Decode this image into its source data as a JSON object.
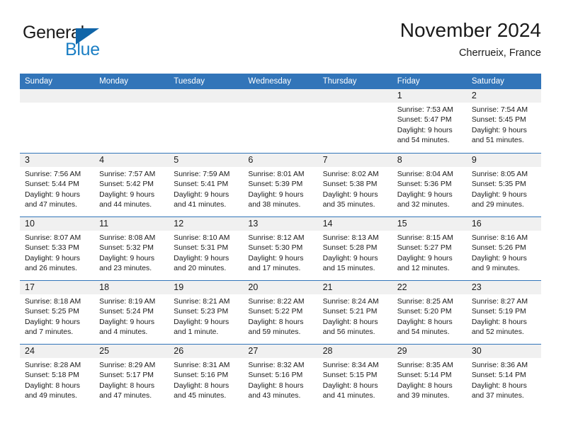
{
  "brand": {
    "name_part1": "General",
    "name_part2": "Blue",
    "accent_color": "#1c7fc4",
    "triangle_color": "#1065a8",
    "triangle_icon": "triangle-right-icon"
  },
  "header": {
    "title": "November 2024",
    "subtitle": "Cherrueix, France"
  },
  "theme": {
    "header_blue": "#3275b9",
    "day_band_gray": "#f0f0f0",
    "text_color": "#1a1a1a"
  },
  "weekdays": [
    "Sunday",
    "Monday",
    "Tuesday",
    "Wednesday",
    "Thursday",
    "Friday",
    "Saturday"
  ],
  "weeks": [
    [
      {
        "day": "",
        "info": ""
      },
      {
        "day": "",
        "info": ""
      },
      {
        "day": "",
        "info": ""
      },
      {
        "day": "",
        "info": ""
      },
      {
        "day": "",
        "info": ""
      },
      {
        "day": "1",
        "info": "Sunrise: 7:53 AM\nSunset: 5:47 PM\nDaylight: 9 hours\nand 54 minutes."
      },
      {
        "day": "2",
        "info": "Sunrise: 7:54 AM\nSunset: 5:45 PM\nDaylight: 9 hours\nand 51 minutes."
      }
    ],
    [
      {
        "day": "3",
        "info": "Sunrise: 7:56 AM\nSunset: 5:44 PM\nDaylight: 9 hours\nand 47 minutes."
      },
      {
        "day": "4",
        "info": "Sunrise: 7:57 AM\nSunset: 5:42 PM\nDaylight: 9 hours\nand 44 minutes."
      },
      {
        "day": "5",
        "info": "Sunrise: 7:59 AM\nSunset: 5:41 PM\nDaylight: 9 hours\nand 41 minutes."
      },
      {
        "day": "6",
        "info": "Sunrise: 8:01 AM\nSunset: 5:39 PM\nDaylight: 9 hours\nand 38 minutes."
      },
      {
        "day": "7",
        "info": "Sunrise: 8:02 AM\nSunset: 5:38 PM\nDaylight: 9 hours\nand 35 minutes."
      },
      {
        "day": "8",
        "info": "Sunrise: 8:04 AM\nSunset: 5:36 PM\nDaylight: 9 hours\nand 32 minutes."
      },
      {
        "day": "9",
        "info": "Sunrise: 8:05 AM\nSunset: 5:35 PM\nDaylight: 9 hours\nand 29 minutes."
      }
    ],
    [
      {
        "day": "10",
        "info": "Sunrise: 8:07 AM\nSunset: 5:33 PM\nDaylight: 9 hours\nand 26 minutes."
      },
      {
        "day": "11",
        "info": "Sunrise: 8:08 AM\nSunset: 5:32 PM\nDaylight: 9 hours\nand 23 minutes."
      },
      {
        "day": "12",
        "info": "Sunrise: 8:10 AM\nSunset: 5:31 PM\nDaylight: 9 hours\nand 20 minutes."
      },
      {
        "day": "13",
        "info": "Sunrise: 8:12 AM\nSunset: 5:30 PM\nDaylight: 9 hours\nand 17 minutes."
      },
      {
        "day": "14",
        "info": "Sunrise: 8:13 AM\nSunset: 5:28 PM\nDaylight: 9 hours\nand 15 minutes."
      },
      {
        "day": "15",
        "info": "Sunrise: 8:15 AM\nSunset: 5:27 PM\nDaylight: 9 hours\nand 12 minutes."
      },
      {
        "day": "16",
        "info": "Sunrise: 8:16 AM\nSunset: 5:26 PM\nDaylight: 9 hours\nand 9 minutes."
      }
    ],
    [
      {
        "day": "17",
        "info": "Sunrise: 8:18 AM\nSunset: 5:25 PM\nDaylight: 9 hours\nand 7 minutes."
      },
      {
        "day": "18",
        "info": "Sunrise: 8:19 AM\nSunset: 5:24 PM\nDaylight: 9 hours\nand 4 minutes."
      },
      {
        "day": "19",
        "info": "Sunrise: 8:21 AM\nSunset: 5:23 PM\nDaylight: 9 hours\nand 1 minute."
      },
      {
        "day": "20",
        "info": "Sunrise: 8:22 AM\nSunset: 5:22 PM\nDaylight: 8 hours\nand 59 minutes."
      },
      {
        "day": "21",
        "info": "Sunrise: 8:24 AM\nSunset: 5:21 PM\nDaylight: 8 hours\nand 56 minutes."
      },
      {
        "day": "22",
        "info": "Sunrise: 8:25 AM\nSunset: 5:20 PM\nDaylight: 8 hours\nand 54 minutes."
      },
      {
        "day": "23",
        "info": "Sunrise: 8:27 AM\nSunset: 5:19 PM\nDaylight: 8 hours\nand 52 minutes."
      }
    ],
    [
      {
        "day": "24",
        "info": "Sunrise: 8:28 AM\nSunset: 5:18 PM\nDaylight: 8 hours\nand 49 minutes."
      },
      {
        "day": "25",
        "info": "Sunrise: 8:29 AM\nSunset: 5:17 PM\nDaylight: 8 hours\nand 47 minutes."
      },
      {
        "day": "26",
        "info": "Sunrise: 8:31 AM\nSunset: 5:16 PM\nDaylight: 8 hours\nand 45 minutes."
      },
      {
        "day": "27",
        "info": "Sunrise: 8:32 AM\nSunset: 5:16 PM\nDaylight: 8 hours\nand 43 minutes."
      },
      {
        "day": "28",
        "info": "Sunrise: 8:34 AM\nSunset: 5:15 PM\nDaylight: 8 hours\nand 41 minutes."
      },
      {
        "day": "29",
        "info": "Sunrise: 8:35 AM\nSunset: 5:14 PM\nDaylight: 8 hours\nand 39 minutes."
      },
      {
        "day": "30",
        "info": "Sunrise: 8:36 AM\nSunset: 5:14 PM\nDaylight: 8 hours\nand 37 minutes."
      }
    ]
  ]
}
